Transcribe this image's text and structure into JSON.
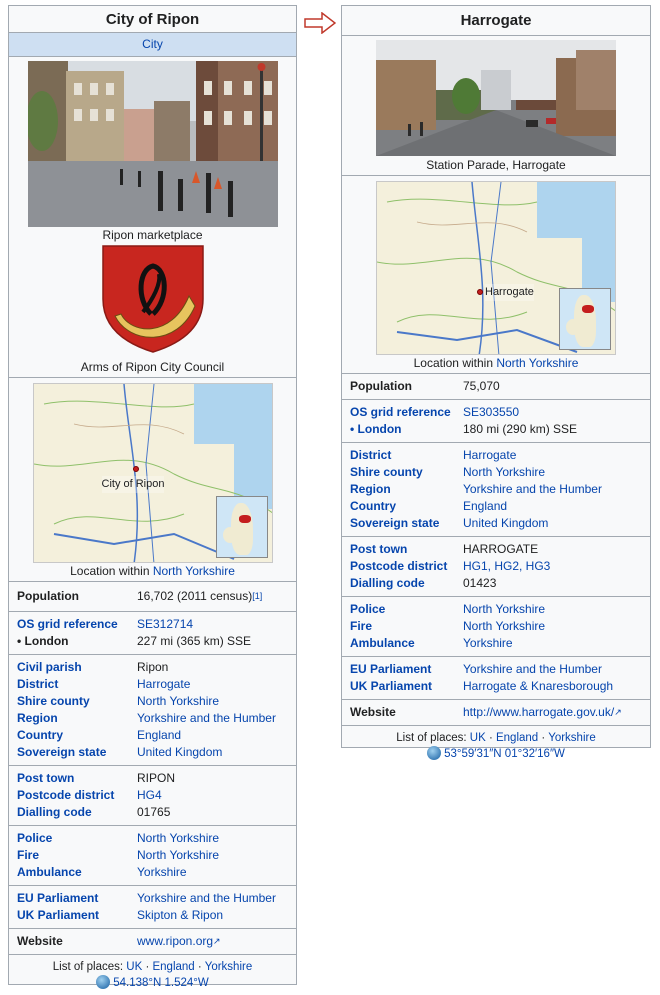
{
  "arrow": {
    "icon": "right-arrow-outline-icon"
  },
  "ripon": {
    "title": "City of Ripon",
    "subtitle": "City",
    "photo_caption": "Ripon marketplace",
    "arms_caption": "Arms of Ripon City Council",
    "map_label": "City of Ripon",
    "map_caption_prefix": "Location within ",
    "map_caption_link": "North Yorkshire",
    "population_label": "Population",
    "population_value": "16,702 (2011 census)",
    "population_ref": "[1]",
    "os_label": "OS grid reference",
    "os_value": "SE312714",
    "london_label": "• London",
    "london_value": "227 mi (365 km) SSE",
    "civil_label": "Civil parish",
    "civil_value": "Ripon",
    "district_label": "District",
    "district_value": "Harrogate",
    "shire_label": "Shire county",
    "shire_value": "North Yorkshire",
    "region_label": "Region",
    "region_value": "Yorkshire and the Humber",
    "country_label": "Country",
    "country_value": "England",
    "sovereign_label": "Sovereign state",
    "sovereign_value": "United Kingdom",
    "posttown_label": "Post town",
    "posttown_value": "RIPON",
    "postcode_label": "Postcode district",
    "postcode_value": "HG4",
    "dialling_label": "Dialling code",
    "dialling_value": "01765",
    "police_label": "Police",
    "police_value": "North Yorkshire",
    "fire_label": "Fire",
    "fire_value": "North Yorkshire",
    "ambulance_label": "Ambulance",
    "ambulance_value": "Yorkshire",
    "eu_label": "EU Parliament",
    "eu_value": "Yorkshire and the Humber",
    "uk_label": "UK Parliament",
    "uk_value": "Skipton & Ripon",
    "website_label": "Website",
    "website_value": "www.ripon.org",
    "places_prefix": "List of places: ",
    "places_uk": "UK",
    "places_england": "England",
    "places_yorkshire": "Yorkshire",
    "sep": " · ",
    "coords": "54.138°N 1.524°W"
  },
  "harrogate": {
    "title": "Harrogate",
    "photo_caption": "Station Parade, Harrogate",
    "map_label": "Harrogate",
    "map_caption_prefix": "Location within ",
    "map_caption_link": "North Yorkshire",
    "population_label": "Population",
    "population_value": "75,070",
    "os_label": "OS grid reference",
    "os_value": "SE303550",
    "london_label": "• London",
    "london_value": "180 mi (290 km) SSE",
    "district_label": "District",
    "district_value": "Harrogate",
    "shire_label": "Shire county",
    "shire_value": "North Yorkshire",
    "region_label": "Region",
    "region_value": "Yorkshire and the Humber",
    "country_label": "Country",
    "country_value": "England",
    "sovereign_label": "Sovereign state",
    "sovereign_value": "United Kingdom",
    "posttown_label": "Post town",
    "posttown_value": "HARROGATE",
    "postcode_label": "Postcode district",
    "postcode_value": "HG1, HG2, HG3",
    "dialling_label": "Dialling code",
    "dialling_value": "01423",
    "police_label": "Police",
    "police_value": "North Yorkshire",
    "fire_label": "Fire",
    "fire_value": "North Yorkshire",
    "ambulance_label": "Ambulance",
    "ambulance_value": "Yorkshire",
    "eu_label": "EU Parliament",
    "eu_value": "Yorkshire and the Humber",
    "uk_label": "UK Parliament",
    "uk_value": "Harrogate & Knaresborough",
    "website_label": "Website",
    "website_value": "http://www.harrogate.gov.uk/",
    "places_prefix": "List of places: ",
    "places_uk": "UK",
    "places_england": "England",
    "places_yorkshire": "Yorkshire",
    "sep": " · ",
    "coords": "53°59′31″N 01°32′16″W"
  }
}
